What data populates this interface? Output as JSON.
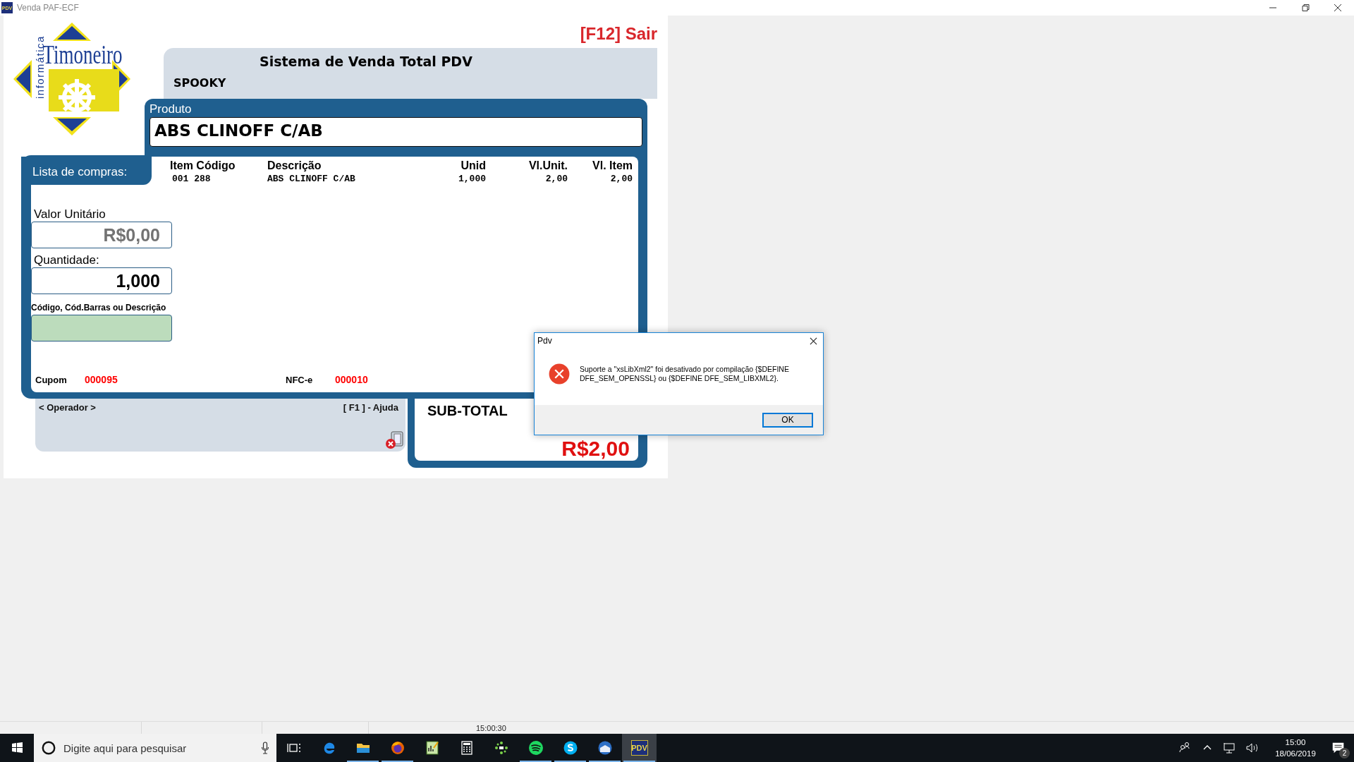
{
  "window": {
    "title": "Venda PAF-ECF",
    "app_icon": "PDV"
  },
  "logo": {
    "name": "Timoneiro",
    "tagline": "informática"
  },
  "exit_button": "[F12] Sair",
  "header": {
    "title": "Sistema de Venda Total PDV",
    "store": "SPOOKY"
  },
  "product": {
    "label": "Produto",
    "value": "ABS CLINOFF C/AB"
  },
  "shopping_list": {
    "label": "Lista de compras:",
    "columns": [
      "Item Código",
      "Descrição",
      "Unid",
      "Vl.Unit.",
      "Vl. Item"
    ],
    "rows": [
      [
        "001 288",
        "ABS CLINOFF C/AB",
        "1,000",
        "2,00",
        "2,00"
      ]
    ]
  },
  "unit_price": {
    "label": "Valor Unitário",
    "value": "R$0,00"
  },
  "quantity": {
    "label": "Quantidade:",
    "value": "1,000"
  },
  "code_search": {
    "label": "Código, Cód.Barras ou Descrição"
  },
  "coupon": {
    "label": "Cupom",
    "value": "000095"
  },
  "nfce": {
    "label": "NFC-e",
    "value": "000010"
  },
  "operator": {
    "label": "< Operador >",
    "help": "[ F1 ] - Ajuda"
  },
  "subtotal": {
    "label": "SUB-TOTAL",
    "value": "R$2,00"
  },
  "dialog": {
    "title": "Pdv",
    "message": "Suporte a \"xsLibXml2\" foi desativado por compilação {$DEFINE\nDFE_SEM_OPENSSL} ou {$DEFINE DFE_SEM_LIBXML2}.",
    "button": "OK"
  },
  "status_bar": {
    "time": "15:00:30"
  },
  "taskbar": {
    "search_placeholder": "Digite aqui para pesquisar",
    "apps": [
      {
        "kind": "task-view",
        "running": false
      },
      {
        "kind": "edge",
        "running": false
      },
      {
        "kind": "folder",
        "running": true
      },
      {
        "kind": "firefox",
        "running": true
      },
      {
        "kind": "notepad",
        "running": false
      },
      {
        "kind": "calculator",
        "running": false
      },
      {
        "kind": "dots",
        "running": false
      },
      {
        "kind": "spotify",
        "running": true
      },
      {
        "kind": "skype",
        "running": true
      },
      {
        "kind": "mail",
        "running": true
      },
      {
        "kind": "pdv",
        "running": true,
        "selected": true,
        "label": "PDV"
      }
    ],
    "clock": {
      "time": "15:00",
      "date": "18/06/2019"
    },
    "notifications": "2"
  }
}
